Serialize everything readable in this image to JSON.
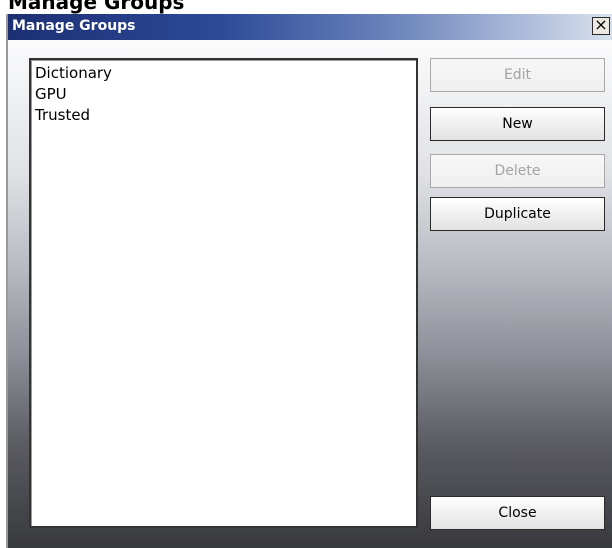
{
  "background_heading": "Manage Groups",
  "dialog": {
    "title": "Manage Groups",
    "close_glyph": "×",
    "groups": [
      "Dictionary",
      "GPU",
      "Trusted"
    ],
    "buttons": {
      "edit": "Edit",
      "new": "New",
      "delete": "Delete",
      "duplicate": "Duplicate",
      "close": "Close"
    }
  }
}
